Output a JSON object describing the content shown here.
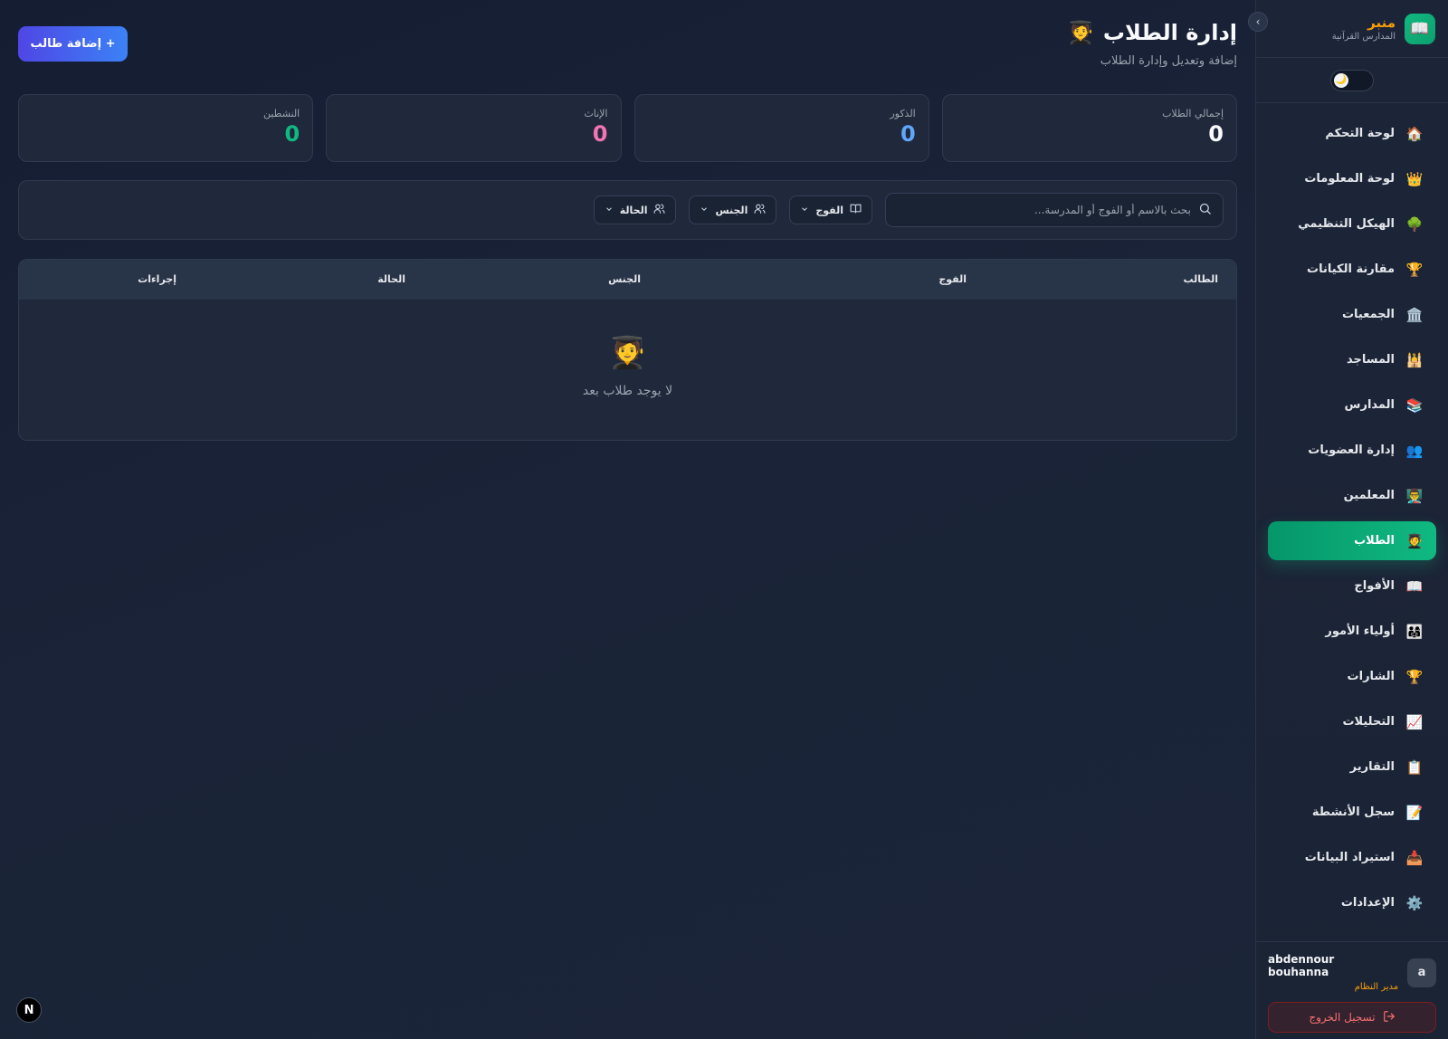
{
  "brand": {
    "name": "منبر",
    "subtitle": "المدارس القرآنية",
    "logo_icon": "📖"
  },
  "collapse": {
    "icon": "›"
  },
  "theme_toggle": {
    "icon": "🌙"
  },
  "sidebar": {
    "items": [
      {
        "label": "لوحة التحكم",
        "icon": "🏠",
        "active": false
      },
      {
        "label": "لوحة المعلومات",
        "icon": "👑",
        "active": false
      },
      {
        "label": "الهيكل التنظيمي",
        "icon": "🌳",
        "active": false
      },
      {
        "label": "مقارنة الكيانات",
        "icon": "🏆",
        "active": false
      },
      {
        "label": "الجمعيات",
        "icon": "🏛️",
        "active": false
      },
      {
        "label": "المساجد",
        "icon": "🕌",
        "active": false
      },
      {
        "label": "المدارس",
        "icon": "📚",
        "active": false
      },
      {
        "label": "إدارة العضويات",
        "icon": "👥",
        "active": false
      },
      {
        "label": "المعلمين",
        "icon": "👨‍🏫",
        "active": false
      },
      {
        "label": "الطلاب",
        "icon": "🧑‍🎓",
        "active": true
      },
      {
        "label": "الأفواج",
        "icon": "📖",
        "active": false
      },
      {
        "label": "أولياء الأمور",
        "icon": "👨‍👩‍👧",
        "active": false
      },
      {
        "label": "الشارات",
        "icon": "🏆",
        "active": false
      },
      {
        "label": "التحليلات",
        "icon": "📈",
        "active": false
      },
      {
        "label": "التقارير",
        "icon": "📋",
        "active": false
      },
      {
        "label": "سجل الأنشطة",
        "icon": "📝",
        "active": false
      },
      {
        "label": "استيراد البيانات",
        "icon": "📥",
        "active": false
      },
      {
        "label": "الإعدادات",
        "icon": "⚙️",
        "active": false
      }
    ]
  },
  "user": {
    "initial": "a",
    "name": "abdennour bouhanna",
    "role": "مدير النظام",
    "logout_label": "تسجيل الخروج"
  },
  "header": {
    "title": "إدارة الطلاب",
    "title_icon": "🧑‍🎓",
    "subtitle": "إضافة وتعديل وإدارة الطلاب",
    "add_button": "+ إضافة طالب"
  },
  "stats": [
    {
      "label": "إجمالي الطلاب",
      "value": "0",
      "color": "#f9fafb"
    },
    {
      "label": "الذكور",
      "value": "0",
      "color": "#60a5fa"
    },
    {
      "label": "الإناث",
      "value": "0",
      "color": "#f472b6"
    },
    {
      "label": "النشطين",
      "value": "0",
      "color": "#10b981"
    }
  ],
  "filters": {
    "search_placeholder": "بحث بالاسم أو الفوج أو المدرسة...",
    "group_label": "الفوج",
    "gender_label": "الجنس",
    "status_label": "الحالة"
  },
  "table": {
    "columns": [
      "الطالب",
      "الفوج",
      "الجنس",
      "الحالة",
      "إجراءات"
    ],
    "empty_icon": "🧑‍🎓",
    "empty_text": "لا يوجد طلاب بعد"
  },
  "dev_badge": "N"
}
